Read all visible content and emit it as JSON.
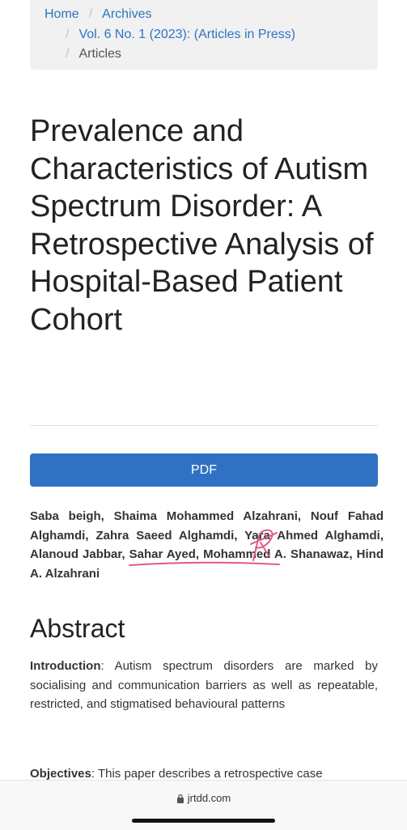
{
  "breadcrumb": {
    "home": "Home",
    "separator": "/",
    "archives": "Archives",
    "issue": "Vol. 6 No. 1 (2023): (Articles in Press)",
    "current": "Articles"
  },
  "article": {
    "title": "Prevalence and Characteristics of Autism Spectrum Disorder: A Retrospective Analysis of Hospital-Based Patient Cohort",
    "pdf_label": "PDF",
    "authors": "Saba beigh, Shaima Mohammed Alzahrani, Nouf Fahad Alghamdi, Zahra Saeed Alghamdi, Yara Ahmed Alghamdi, Alanoud Jabbar, Sahar Ayed, Mohammed A. Shanawaz, Hind A. Alzahrani"
  },
  "abstract": {
    "heading": "Abstract",
    "intro_label": "Introduction",
    "intro_text": ": Autism spectrum disorders are marked by socialising and communication barriers as well as repeatable, restricted, and stigmatised behavioural patterns",
    "objectives_label": "Objectives",
    "objectives_text": ": This paper describes a retrospective case"
  },
  "browser": {
    "url": "jrtdd.com",
    "lock_icon": "lock-icon"
  },
  "colors": {
    "link": "#2f73c4",
    "button": "#2f72c3",
    "annotation": "#e05a86"
  }
}
